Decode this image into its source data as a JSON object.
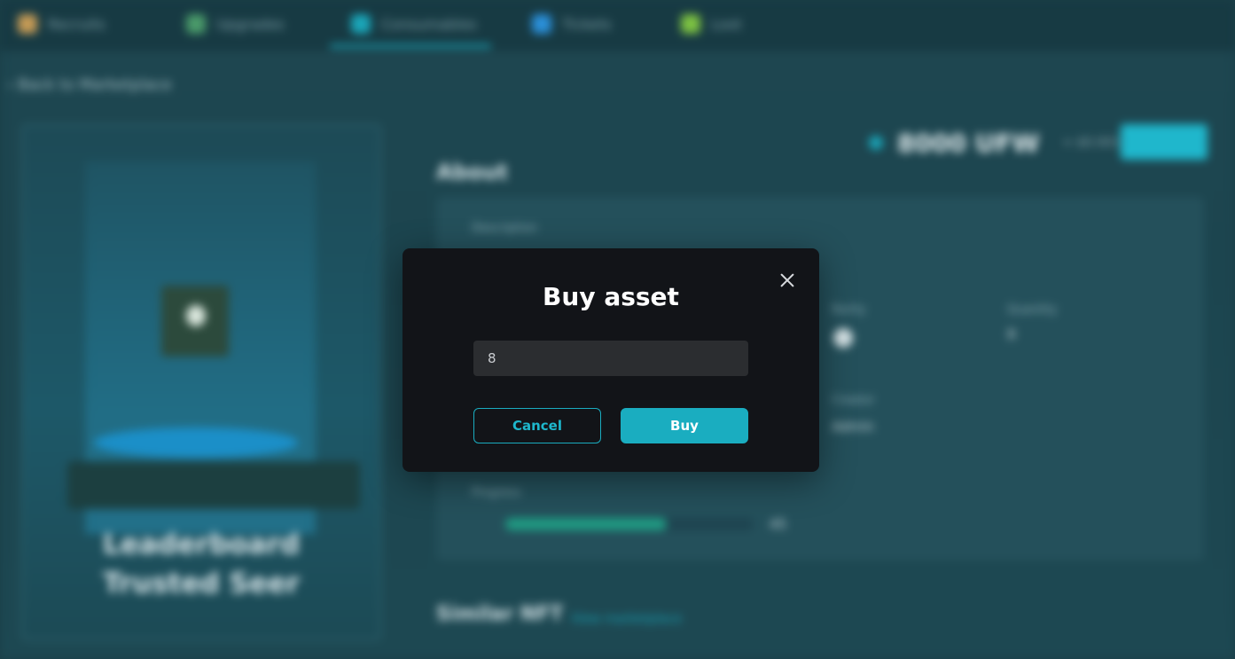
{
  "background": {
    "nav": {
      "items": [
        {
          "label": "Recruits",
          "icon": "helmet-icon",
          "color": "#c49a55"
        },
        {
          "label": "Upgrades",
          "icon": "upgrade-icon",
          "color": "#4a9a6a"
        },
        {
          "label": "Consumables",
          "icon": "potion-icon",
          "color": "#1aa5b8"
        },
        {
          "label": "Tickets",
          "icon": "ticket-icon",
          "color": "#2a8fd8"
        },
        {
          "label": "Loot",
          "icon": "loot-icon",
          "color": "#7cc142"
        }
      ],
      "active_index": 2
    },
    "back_label": "Back to Marketplace",
    "nft": {
      "title": "Leaderboard Trusted Seer"
    },
    "price": {
      "amount": "8000 UFW",
      "sub": "≈ $0.0016",
      "buy_label": "Buy now"
    },
    "about": {
      "heading": "About",
      "description_label": "Description",
      "stats": [
        {
          "label": "Rarity",
          "value": ""
        },
        {
          "label": "Quantity",
          "value": "8"
        },
        {
          "label": "Creator",
          "value": "Admin"
        }
      ],
      "progress_label": "Progress",
      "progress_fraction": 0.65,
      "progress_value": "45"
    },
    "similar": {
      "heading": "Similar NFT",
      "link": "View marketplace"
    }
  },
  "modal": {
    "title": "Buy asset",
    "input_value": "8",
    "cancel_label": "Cancel",
    "buy_label": "Buy",
    "accent_color": "#1aadc0"
  }
}
